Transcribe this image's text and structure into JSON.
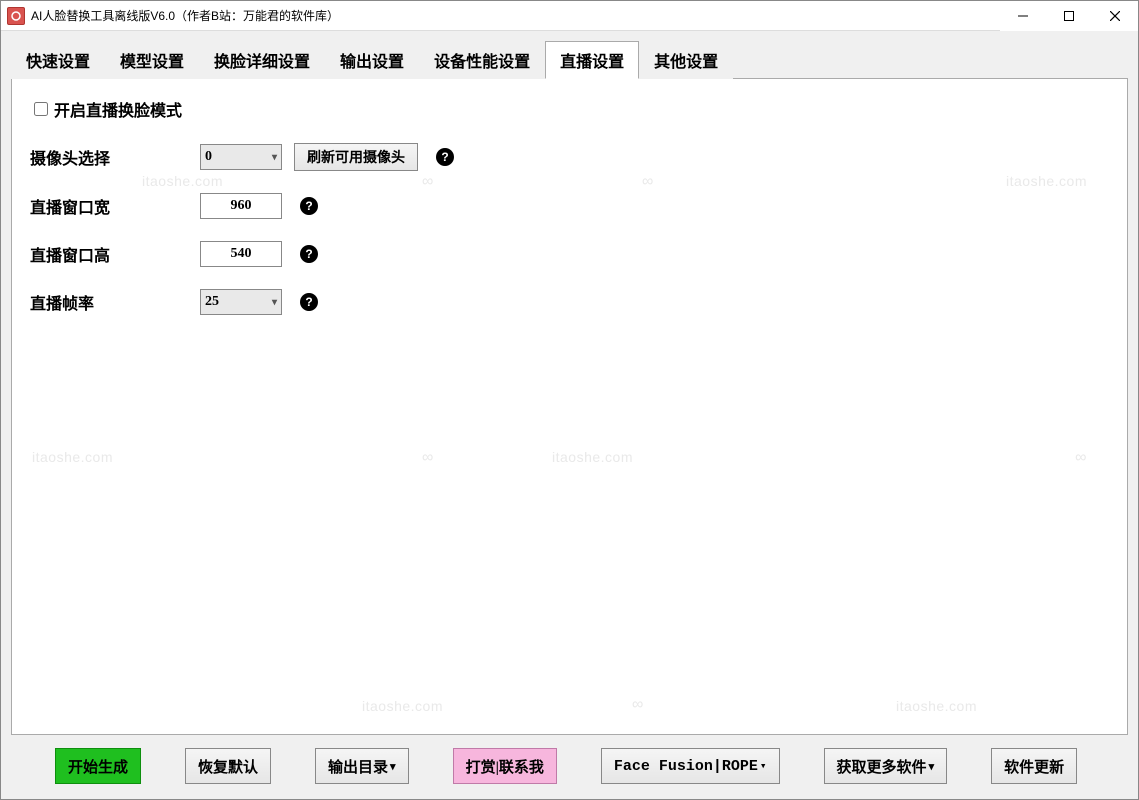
{
  "window": {
    "title": "AI人脸替换工具离线版V6.0（作者B站：万能君的软件库）"
  },
  "tabs": [
    "快速设置",
    "模型设置",
    "换脸详细设置",
    "输出设置",
    "设备性能设置",
    "直播设置",
    "其他设置"
  ],
  "activeTab": 5,
  "form": {
    "enableLiveLabel": "开启直播换脸模式",
    "cameraSelectLabel": "摄像头选择",
    "cameraValue": "0",
    "refreshCameraBtn": "刷新可用摄像头",
    "widthLabel": "直播窗口宽",
    "widthValue": "960",
    "heightLabel": "直播窗口高",
    "heightValue": "540",
    "fpsLabel": "直播帧率",
    "fpsValue": "25"
  },
  "bottom": {
    "start": "开始生成",
    "restore": "恢复默认",
    "outputDir": "输出目录",
    "donate": "打赏|联系我",
    "rope": "Face Fusion|ROPE",
    "more": "获取更多软件",
    "update": "软件更新"
  },
  "watermark": "itaoshe.com"
}
